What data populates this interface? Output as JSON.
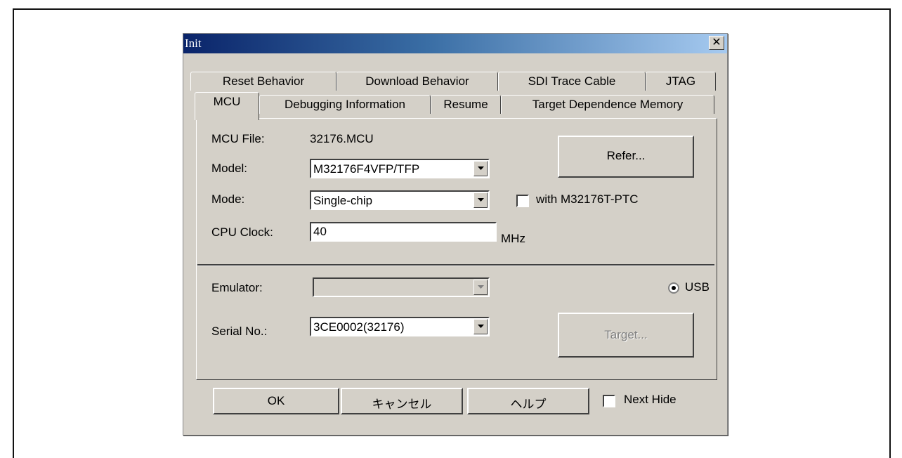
{
  "dialog": {
    "title": "Init",
    "close_glyph": "✕"
  },
  "tabs_row1": [
    "Reset Behavior",
    "Download Behavior",
    "SDI Trace Cable",
    "JTAG"
  ],
  "tabs_row2": [
    "MCU",
    "Debugging Information",
    "Resume",
    "Target Dependence Memory"
  ],
  "active_tab": "MCU",
  "mcu": {
    "mcu_file_label": "MCU File:",
    "mcu_file_value": "32176.MCU",
    "refer_button": "Refer...",
    "model_label": "Model:",
    "model_value": "M32176F4VFP/TFP",
    "mode_label": "Mode:",
    "mode_value": "Single-chip",
    "ptc_checkbox_label": "with M32176T-PTC",
    "ptc_checked": false,
    "cpu_clock_label": "CPU Clock:",
    "cpu_clock_value": "40",
    "cpu_clock_unit": "MHz"
  },
  "emulator": {
    "emulator_label": "Emulator:",
    "emulator_value": "",
    "usb_label": "USB",
    "usb_selected": true,
    "serial_label": "Serial No.:",
    "serial_value": "3CE0002(32176)",
    "target_button": "Target..."
  },
  "footer": {
    "ok_button": "OK",
    "cancel_button": "キャンセル",
    "help_button": "ヘルプ",
    "next_hide_label": "Next Hide",
    "next_hide_checked": false
  },
  "colors": {
    "dialog_bg": "#d4d0c8",
    "title_gradient_start": "#0a246a",
    "title_gradient_end": "#a6caf0"
  }
}
